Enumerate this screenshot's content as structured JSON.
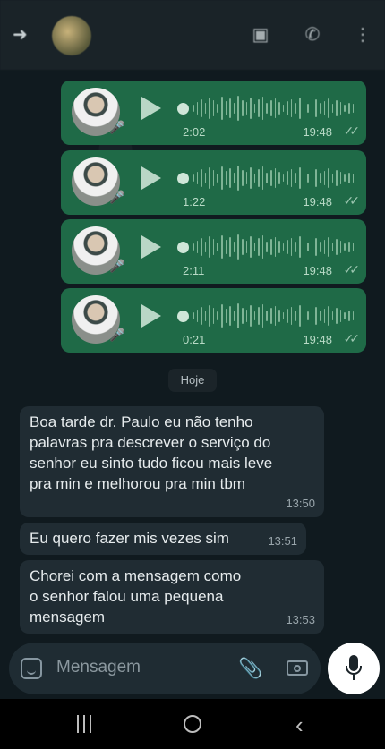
{
  "header": {
    "back_icon": "arrow-left-icon",
    "title": "",
    "icons": [
      "video-call-icon",
      "phone-icon",
      "more-vertical-icon"
    ]
  },
  "voice_messages": [
    {
      "duration": "2:02",
      "time": "19:48",
      "status": "read"
    },
    {
      "duration": "1:22",
      "time": "19:48",
      "status": "read"
    },
    {
      "duration": "2:11",
      "time": "19:48",
      "status": "read"
    },
    {
      "duration": "0:21",
      "time": "19:48",
      "status": "read"
    }
  ],
  "date_divider": "Hoje",
  "messages": [
    {
      "lines": [
        "Boa tarde dr. Paulo eu não tenho",
        "palavras pra descrever o serviço do",
        "senhor eu sinto tudo ficou mais leve",
        "pra min e melhorou pra min tbm"
      ],
      "time": "13:50"
    },
    {
      "lines": [
        "Eu quero fazer mis vezes sim"
      ],
      "time": "13:51"
    },
    {
      "lines": [
        "Chorei com a mensagem como",
        "o senhor falou uma pequena",
        "mensagem"
      ],
      "time": "13:53"
    }
  ],
  "input": {
    "placeholder": "Mensagem"
  },
  "colors": {
    "outgoing_bubble": "#1f6a47",
    "incoming_bubble": "#202c33",
    "background": "#101a1f"
  }
}
